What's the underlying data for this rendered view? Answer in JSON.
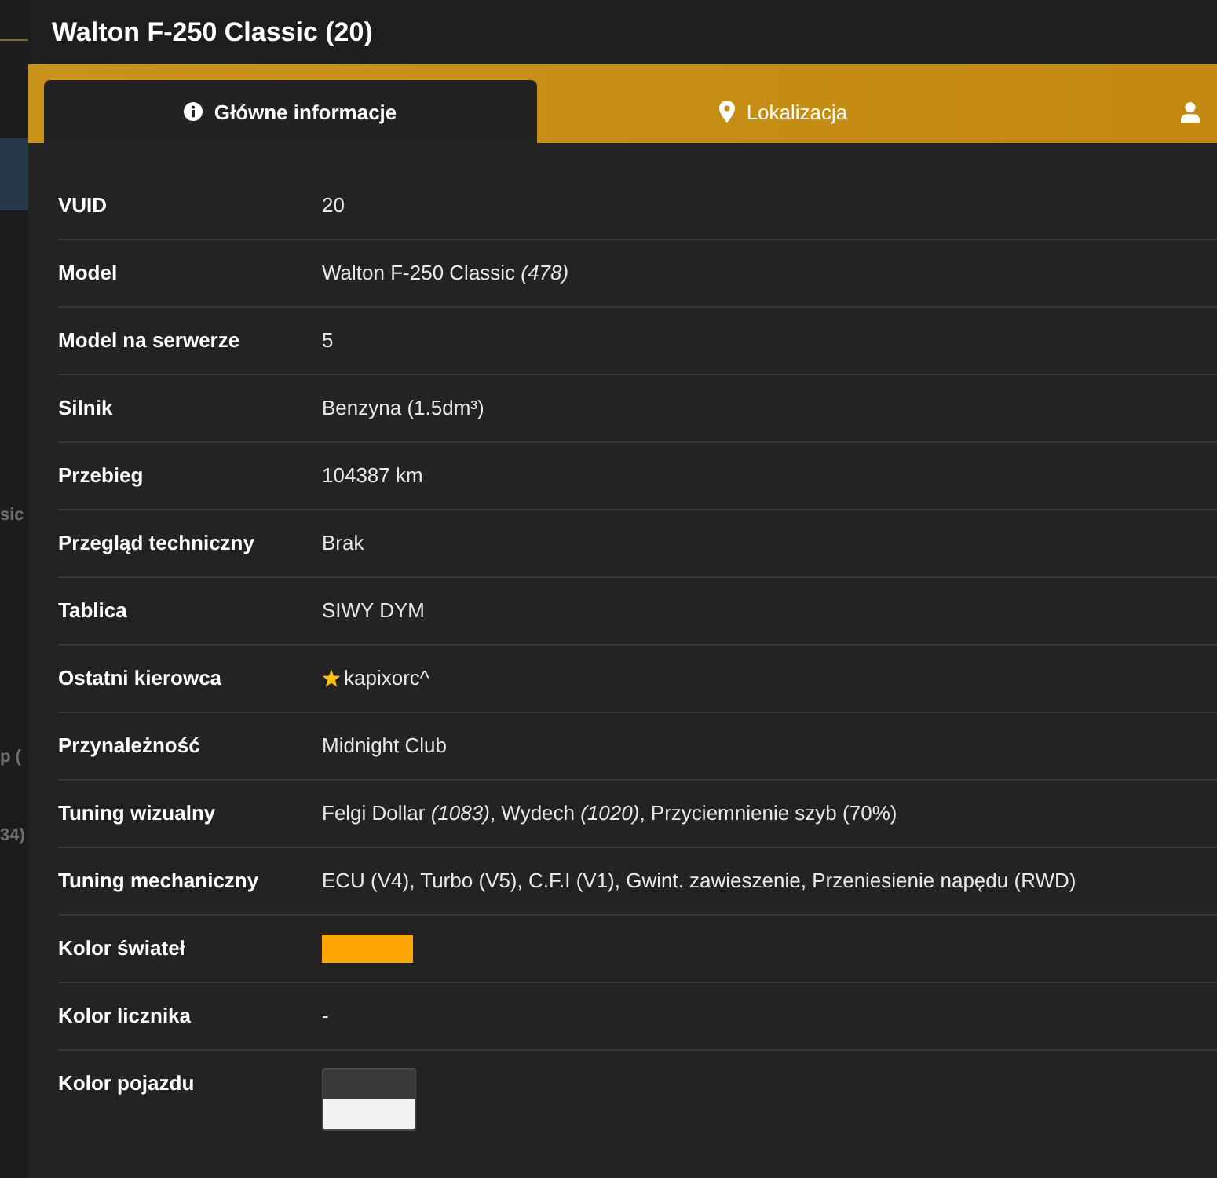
{
  "background": {
    "texts": [
      "sic",
      "p (",
      "34)"
    ]
  },
  "window": {
    "title": "Walton F-250 Classic (20)"
  },
  "tabs": [
    {
      "label": "Główne informacje",
      "selected": true
    },
    {
      "label": "Lokalizacja",
      "selected": false
    },
    {
      "selected": false
    }
  ],
  "rows": [
    {
      "kind": "text",
      "label": "VUID",
      "value": "20"
    },
    {
      "kind": "text",
      "label": "Model",
      "value": "Walton F-250 Classic *(478)*"
    },
    {
      "kind": "text",
      "label": "Model na serwerze",
      "value": "5"
    },
    {
      "kind": "text",
      "label": "Silnik",
      "value": "Benzyna (1.5dm³)"
    },
    {
      "kind": "text",
      "label": "Przebieg",
      "value": "104387 km"
    },
    {
      "kind": "text",
      "label": "Przegląd techniczny",
      "value": "Brak"
    },
    {
      "kind": "text",
      "label": "Tablica",
      "value": "SIWY DYM"
    },
    {
      "kind": "starred",
      "label": "Ostatni kierowca",
      "value": "kapixorc^"
    },
    {
      "kind": "text",
      "label": "Przynależność",
      "value": "Midnight Club"
    },
    {
      "kind": "text",
      "label": "Tuning wizualny",
      "value": "Felgi Dollar *(1083)*, Wydech *(1020)*, Przyciemnienie szyb (70%)"
    },
    {
      "kind": "text",
      "label": "Tuning mechaniczny",
      "value": "ECU (V4), Turbo (V5), C.F.I (V1), Gwint. zawieszenie, Przeniesienie napędu (RWD)"
    },
    {
      "kind": "swatch",
      "label": "Kolor świateł",
      "color": "#ffa500"
    },
    {
      "kind": "text",
      "label": "Kolor licznika",
      "value": "-"
    },
    {
      "kind": "swatches",
      "label": "Kolor pojazdu",
      "swatches": [
        {
          "color": "#3a3a3a"
        },
        {
          "color": "#f2f2f2"
        }
      ]
    }
  ]
}
